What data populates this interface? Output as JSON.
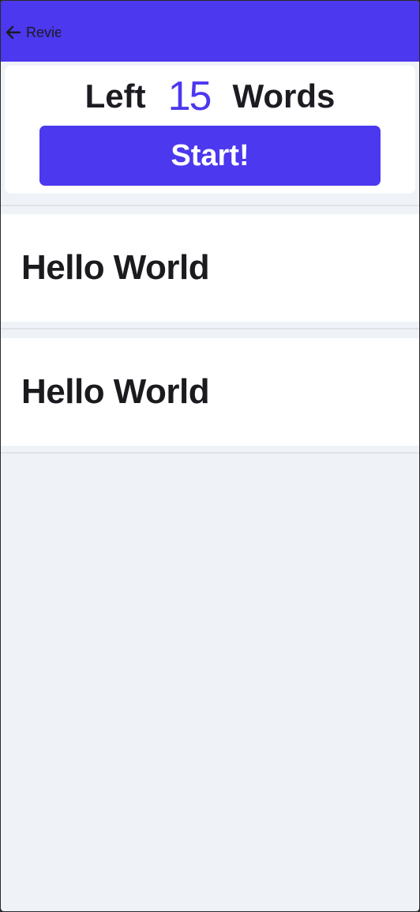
{
  "app_bar": {
    "back_label": "Revie",
    "back_icon": "arrow-left-icon",
    "color": "#4c38ee"
  },
  "counter": {
    "prefix": "Left",
    "count": "15",
    "suffix": "Words",
    "count_color": "#4c38ee"
  },
  "start_button": {
    "label": "Start!",
    "color": "#4c38ee"
  },
  "word_list": [
    {
      "text": "Hello World"
    },
    {
      "text": "Hello World"
    }
  ]
}
